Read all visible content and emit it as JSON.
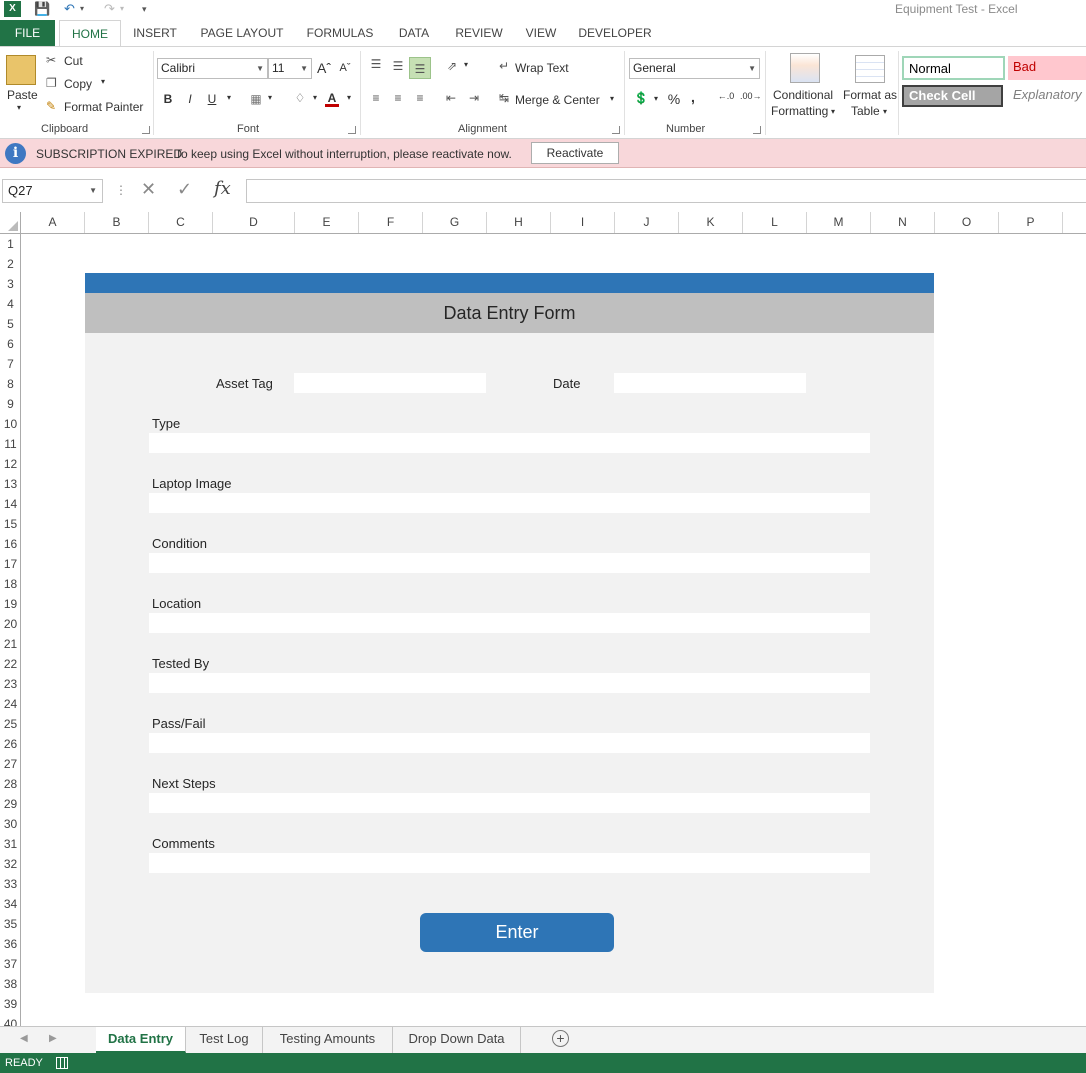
{
  "window": {
    "title": "Equipment Test - Excel"
  },
  "ribbon_tabs": [
    "FILE",
    "HOME",
    "INSERT",
    "PAGE LAYOUT",
    "FORMULAS",
    "DATA",
    "REVIEW",
    "VIEW",
    "DEVELOPER"
  ],
  "active_tab": "HOME",
  "clipboard": {
    "paste": "Paste",
    "cut": "Cut",
    "copy": "Copy",
    "format_painter": "Format Painter",
    "label": "Clipboard"
  },
  "font": {
    "name": "Calibri",
    "size": "11",
    "bold": "B",
    "italic": "I",
    "underline": "U",
    "label": "Font"
  },
  "alignment": {
    "wrap_text": "Wrap Text",
    "merge_center": "Merge & Center",
    "label": "Alignment"
  },
  "number": {
    "format": "General",
    "percent": "%",
    "comma": ",",
    "label": "Number"
  },
  "styles": {
    "conditional_formatting": "Conditional\nFormatting",
    "conditional_formatting_line1": "Conditional",
    "conditional_formatting_line2": "Formatting",
    "format_as_table_line1": "Format as",
    "format_as_table_line2": "Table",
    "normal": "Normal",
    "bad": "Bad",
    "check_cell": "Check Cell",
    "explanatory": "Explanatory"
  },
  "message_bar": {
    "title": "SUBSCRIPTION EXPIRED",
    "text": "To keep using Excel without interruption, please reactivate now.",
    "button": "Reactivate"
  },
  "formula_bar": {
    "name_box": "Q27",
    "fx": "fx",
    "value": ""
  },
  "columns": [
    "A",
    "B",
    "C",
    "D",
    "E",
    "F",
    "G",
    "H",
    "I",
    "J",
    "K",
    "L",
    "M",
    "N",
    "O",
    "P"
  ],
  "rows": [
    "1",
    "2",
    "3",
    "4",
    "5",
    "6",
    "7",
    "8",
    "9",
    "10",
    "11",
    "12",
    "13",
    "14",
    "15",
    "16",
    "17",
    "18",
    "19",
    "20",
    "21",
    "22",
    "23",
    "24",
    "25",
    "26",
    "27",
    "28",
    "29",
    "30",
    "31",
    "32",
    "33",
    "34",
    "35",
    "36",
    "37",
    "38",
    "39",
    "40"
  ],
  "form": {
    "title": "Data Entry Form",
    "asset_tag_label": "Asset Tag",
    "date_label": "Date",
    "fields": [
      "Type",
      "Laptop Image",
      "Condition",
      "Location",
      "Tested By",
      "Pass/Fail",
      "Next Steps",
      "Comments"
    ],
    "enter_button": "Enter"
  },
  "sheet_tabs": [
    "Data Entry",
    "Test Log",
    "Testing Amounts",
    "Drop Down Data"
  ],
  "active_sheet": "Data Entry",
  "status": {
    "ready": "READY"
  },
  "colors": {
    "excel_green": "#217346",
    "form_blue": "#2e75b6",
    "form_title_gray": "#bfbfbf",
    "form_bg": "#f2f2f2",
    "message_pink": "#f8d7da"
  }
}
